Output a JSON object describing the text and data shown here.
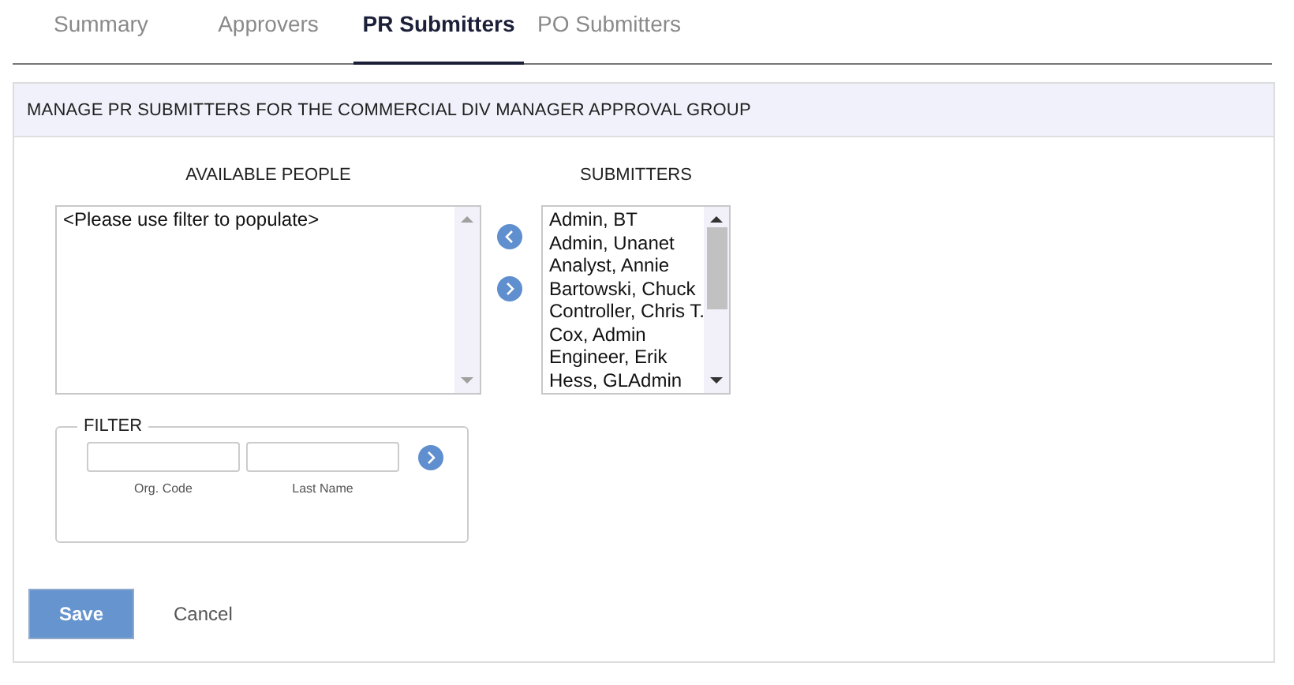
{
  "tabs": [
    {
      "label": "Summary",
      "selected": false
    },
    {
      "label": "Approvers",
      "selected": false
    },
    {
      "label": "PR Submitters",
      "selected": true
    },
    {
      "label": "PO Submitters",
      "selected": false
    }
  ],
  "panel": {
    "title": "MANAGE PR SUBMITTERS FOR THE COMMERCIAL DIV MANAGER APPROVAL GROUP",
    "available": {
      "heading": "AVAILABLE PEOPLE",
      "items": [
        "<Please use filter to populate>"
      ]
    },
    "submitters": {
      "heading": "SUBMITTERS",
      "items": [
        "Admin, BT",
        "Admin, Unanet",
        "Analyst, Annie",
        "Bartowski, Chuck",
        "Controller, Chris T.",
        "Cox, Admin",
        "Engineer, Erik",
        "Hess, GLAdmin"
      ]
    },
    "filter": {
      "legend": "FILTER",
      "fields": [
        {
          "label": "Org. Code"
        },
        {
          "label": "Last Name"
        }
      ]
    }
  },
  "buttons": {
    "save": "Save",
    "cancel": "Cancel"
  }
}
